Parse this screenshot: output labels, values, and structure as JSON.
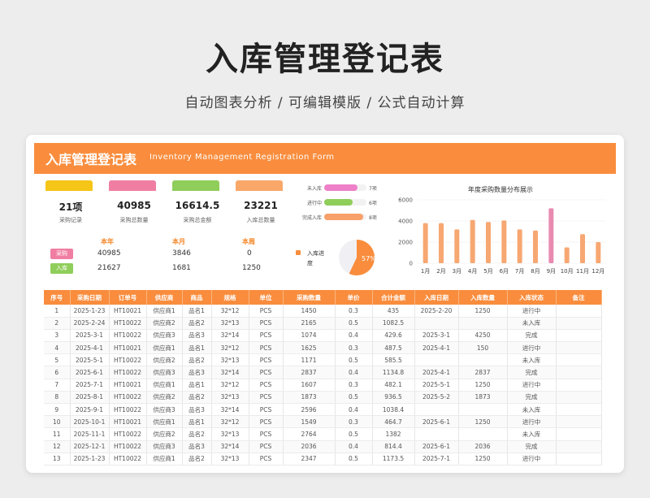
{
  "hero": {
    "title": "入库管理登记表",
    "subtitle": "自动图表分析 / 可编辑模版 / 公式自动计算"
  },
  "banner": {
    "title": "入库管理登记表",
    "title_en": "Inventory Management Registration Form"
  },
  "cards": [
    {
      "value": "21项",
      "label": "采购记录",
      "color": "#f5c518"
    },
    {
      "value": "40985",
      "label": "采购总数量",
      "color": "#f07ea3"
    },
    {
      "value": "16614.5",
      "label": "采购总金额",
      "color": "#8fce5a"
    },
    {
      "value": "23221",
      "label": "入库总数量",
      "color": "#f9a86a"
    }
  ],
  "progress": [
    {
      "label": "未入库",
      "value": "7项",
      "fraction": 0.78,
      "color": "#ee7fc8"
    },
    {
      "label": "进行中",
      "value": "6项",
      "fraction": 0.67,
      "color": "#8fce5a"
    },
    {
      "label": "完成入库",
      "value": "8项",
      "fraction": 0.92,
      "color": "#f7a06a"
    }
  ],
  "period": {
    "headers": [
      "本年",
      "本月",
      "本周"
    ],
    "rows": [
      {
        "tag": "采购",
        "tag_color": "#f07ea3",
        "values": [
          "40985",
          "3846",
          "0"
        ]
      },
      {
        "tag": "入库",
        "tag_color": "#8fce5a",
        "values": [
          "21627",
          "1681",
          "1250"
        ]
      }
    ]
  },
  "inbound": {
    "label": "入库进度",
    "percent_text": "57%",
    "percent": 57,
    "color": "#f98d3d"
  },
  "chart_data": {
    "type": "bar",
    "title": "年度采购数量分布展示",
    "categories": [
      "1月",
      "2月",
      "3月",
      "4月",
      "5月",
      "6月",
      "7月",
      "8月",
      "9月",
      "10月",
      "11月",
      "12月"
    ],
    "values": [
      3800,
      3800,
      3200,
      4100,
      3900,
      4050,
      3200,
      3100,
      5200,
      1500,
      2750,
      2000
    ],
    "highlight_index": 8,
    "ylim": [
      0,
      6000
    ],
    "yticks": [
      0,
      2000,
      4000,
      6000
    ],
    "ytick_labels": [
      "0",
      "2000",
      "4000",
      "6000"
    ],
    "bar_color": "#f7a772",
    "highlight_color": "#e98ab0",
    "grid": true
  },
  "table": {
    "headers": [
      "序号",
      "采购日期",
      "订单号",
      "供应商",
      "商品",
      "规格",
      "单位",
      "采购数量",
      "单价",
      "合计金额",
      "入库日期",
      "入库数量",
      "入库状态",
      "备注"
    ],
    "rows": [
      [
        "1",
        "2025-1-23",
        "HT10021",
        "供应商1",
        "品名1",
        "32*12",
        "PCS",
        "1450",
        "0.3",
        "435",
        "2025-2-20",
        "1250",
        "进行中",
        ""
      ],
      [
        "2",
        "2025-2-24",
        "HT10022",
        "供应商2",
        "品名2",
        "32*13",
        "PCS",
        "2165",
        "0.5",
        "1082.5",
        "",
        "",
        "未入库",
        ""
      ],
      [
        "3",
        "2025-3-1",
        "HT10022",
        "供应商3",
        "品名3",
        "32*14",
        "PCS",
        "1074",
        "0.4",
        "429.6",
        "2025-3-1",
        "4250",
        "完成",
        ""
      ],
      [
        "4",
        "2025-4-1",
        "HT10021",
        "供应商1",
        "品名1",
        "32*12",
        "PCS",
        "1625",
        "0.3",
        "487.5",
        "2025-4-1",
        "150",
        "进行中",
        ""
      ],
      [
        "5",
        "2025-5-1",
        "HT10022",
        "供应商2",
        "品名2",
        "32*13",
        "PCS",
        "1171",
        "0.5",
        "585.5",
        "",
        "",
        "未入库",
        ""
      ],
      [
        "6",
        "2025-6-1",
        "HT10022",
        "供应商3",
        "品名3",
        "32*14",
        "PCS",
        "2837",
        "0.4",
        "1134.8",
        "2025-4-1",
        "2837",
        "完成",
        ""
      ],
      [
        "7",
        "2025-7-1",
        "HT10021",
        "供应商1",
        "品名1",
        "32*12",
        "PCS",
        "1607",
        "0.3",
        "482.1",
        "2025-5-1",
        "1250",
        "进行中",
        ""
      ],
      [
        "8",
        "2025-8-1",
        "HT10022",
        "供应商2",
        "品名2",
        "32*13",
        "PCS",
        "1873",
        "0.5",
        "936.5",
        "2025-5-2",
        "1873",
        "完成",
        ""
      ],
      [
        "9",
        "2025-9-1",
        "HT10022",
        "供应商3",
        "品名3",
        "32*14",
        "PCS",
        "2596",
        "0.4",
        "1038.4",
        "",
        "",
        "未入库",
        ""
      ],
      [
        "10",
        "2025-10-1",
        "HT10021",
        "供应商1",
        "品名1",
        "32*12",
        "PCS",
        "1549",
        "0.3",
        "464.7",
        "2025-6-1",
        "1250",
        "进行中",
        ""
      ],
      [
        "11",
        "2025-11-1",
        "HT10022",
        "供应商2",
        "品名2",
        "32*13",
        "PCS",
        "2764",
        "0.5",
        "1382",
        "",
        "",
        "未入库",
        ""
      ],
      [
        "12",
        "2025-12-1",
        "HT10022",
        "供应商3",
        "品名3",
        "32*14",
        "PCS",
        "2036",
        "0.4",
        "814.4",
        "2025-6-1",
        "2036",
        "完成",
        ""
      ],
      [
        "13",
        "2025-1-23",
        "HT10022",
        "供应商1",
        "品名2",
        "32*13",
        "PCS",
        "2347",
        "0.5",
        "1173.5",
        "2025-7-1",
        "1250",
        "进行中",
        ""
      ]
    ]
  }
}
